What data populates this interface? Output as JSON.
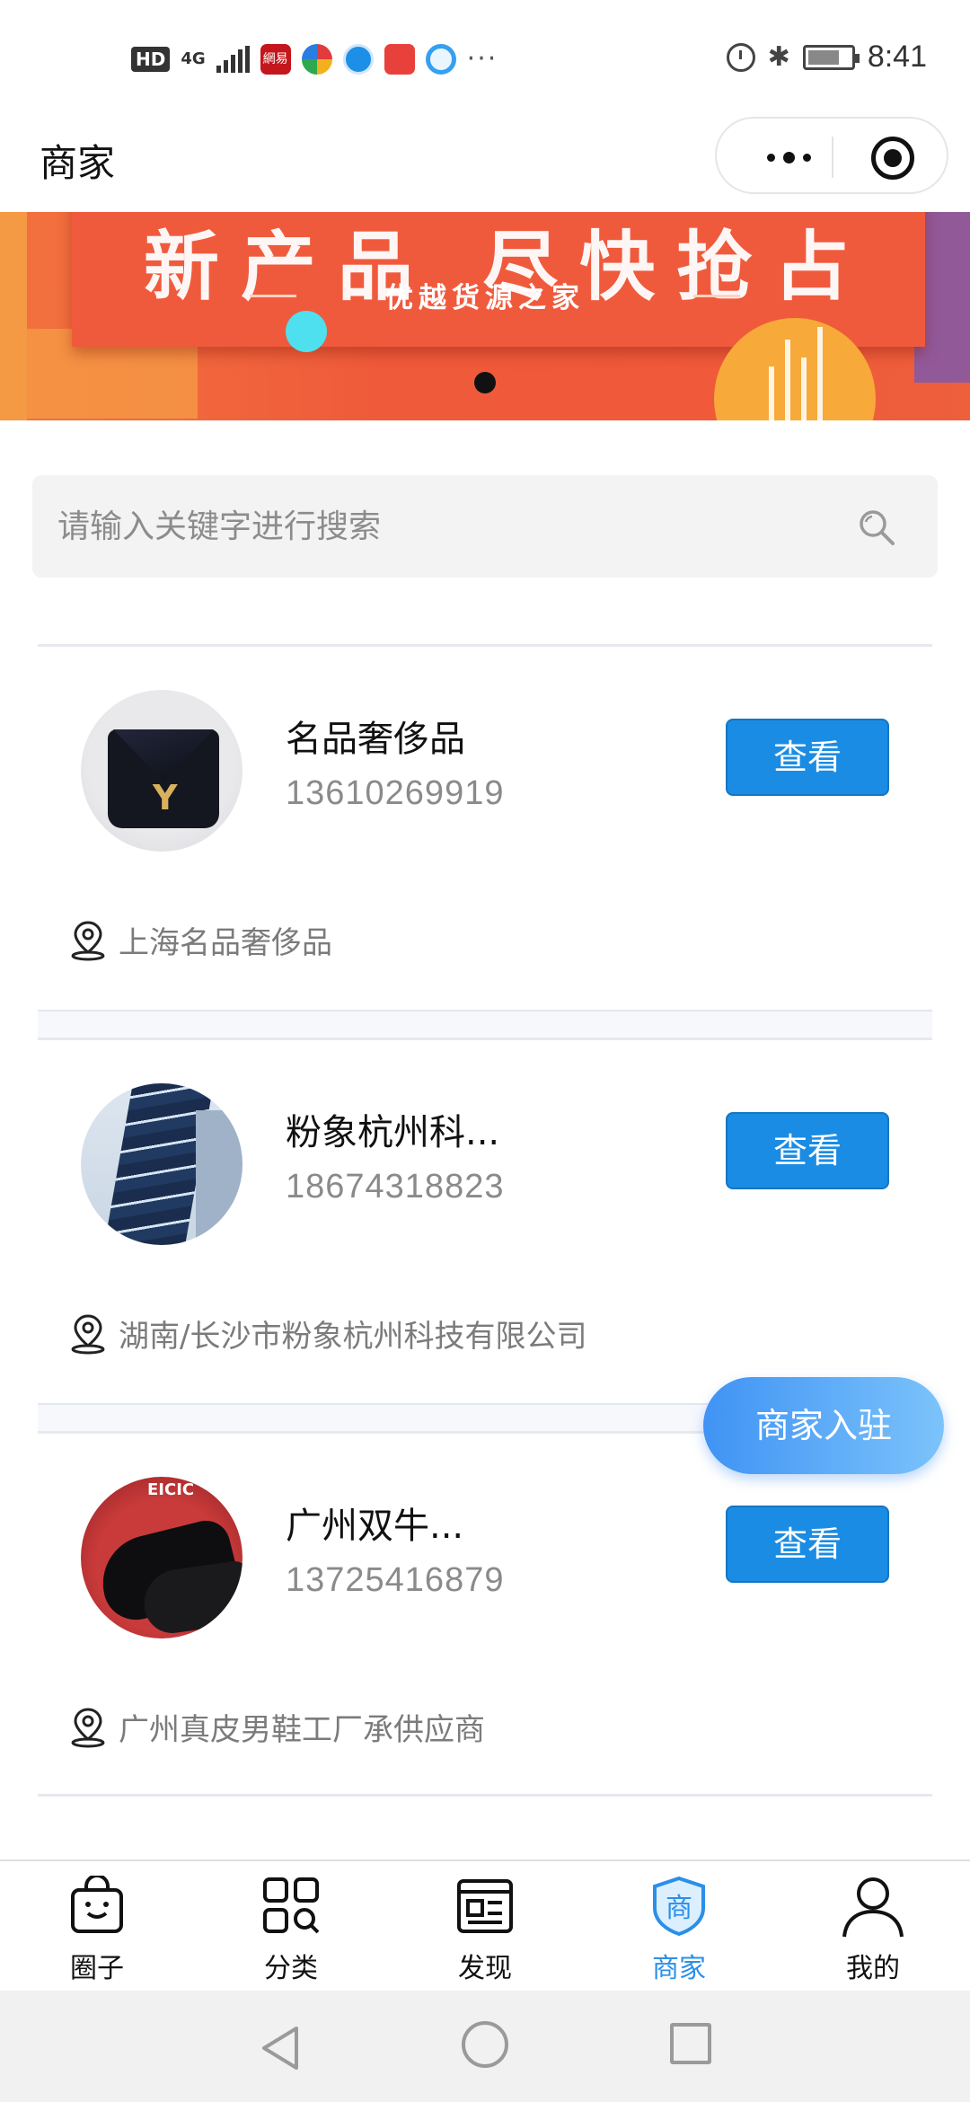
{
  "status_bar": {
    "hd": "HD",
    "network": "4G",
    "netease_label": "網易",
    "more": "···",
    "time": "8:41"
  },
  "nav": {
    "title": "商家"
  },
  "banner": {
    "headline": "新产品 尽快抢占",
    "subtitle": "优越货源之家"
  },
  "search": {
    "placeholder": "请输入关键字进行搜索",
    "value": ""
  },
  "merchants": [
    {
      "name": "名品奢侈品",
      "phone": "13610269919",
      "address": "上海名品奢侈品",
      "button": "查看",
      "avatar": "handbag-photo"
    },
    {
      "name": "粉象杭州科...",
      "phone": "18674318823",
      "address": "湖南/长沙市粉象杭州科技有限公司",
      "button": "查看",
      "avatar": "building-photo"
    },
    {
      "name": "广州双牛...",
      "phone": "13725416879",
      "address": "广州真皮男鞋工厂承供应商",
      "button": "查看",
      "avatar": "shoe-photo"
    }
  ],
  "join_button": "商家入驻",
  "tabs": [
    {
      "label": "圈子",
      "icon": "bag-smile-icon",
      "active": false
    },
    {
      "label": "分类",
      "icon": "category-search-icon",
      "active": false
    },
    {
      "label": "发现",
      "icon": "discover-card-icon",
      "active": false
    },
    {
      "label": "商家",
      "icon": "merchant-shield-icon",
      "active": true
    },
    {
      "label": "我的",
      "icon": "person-icon",
      "active": false
    }
  ],
  "colors": {
    "accent": "#1b8ce3",
    "tab_active": "#2b8fe8",
    "banner": "#f05a3c"
  }
}
